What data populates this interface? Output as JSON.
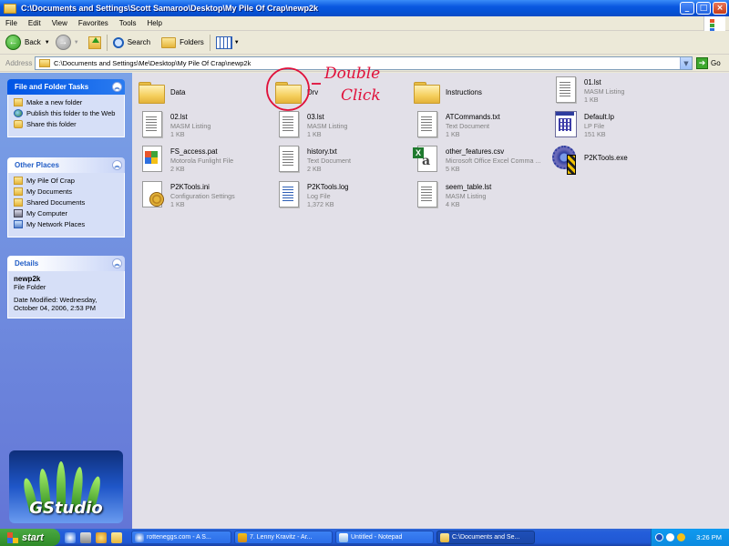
{
  "window": {
    "title": "C:\\Documents and Settings\\Scott Samaroo\\Desktop\\My Pile Of Crap\\newp2k",
    "controls": {
      "minimize": "_",
      "maximize": "□",
      "close": "×"
    }
  },
  "menu": [
    "File",
    "Edit",
    "View",
    "Favorites",
    "Tools",
    "Help"
  ],
  "toolbar": {
    "back": "Back",
    "search": "Search",
    "folders": "Folders"
  },
  "address": {
    "label": "Address",
    "value": "C:\\Documents and Settings\\Me\\Desktop\\My Pile Of Crap\\newp2k",
    "go": "Go"
  },
  "sidebar": {
    "tasks": {
      "title": "File and Folder Tasks",
      "items": [
        {
          "label": "Make a new folder",
          "icon": "new-folder-icon"
        },
        {
          "label": "Publish this folder to the Web",
          "icon": "globe-icon"
        },
        {
          "label": "Share this folder",
          "icon": "share-icon"
        }
      ]
    },
    "places": {
      "title": "Other Places",
      "items": [
        {
          "label": "My Pile Of Crap",
          "icon": "folder-icon"
        },
        {
          "label": "My Documents",
          "icon": "documents-icon"
        },
        {
          "label": "Shared Documents",
          "icon": "folder-icon"
        },
        {
          "label": "My Computer",
          "icon": "computer-icon"
        },
        {
          "label": "My Network Places",
          "icon": "network-icon"
        }
      ]
    },
    "details": {
      "title": "Details",
      "name": "newp2k",
      "type": "File Folder",
      "modified": "Date Modified: Wednesday, October 04, 2006, 2:53 PM"
    },
    "logo_text": "GStudio"
  },
  "files": [
    {
      "name": "Data",
      "type": "",
      "size": "",
      "icon": "folder"
    },
    {
      "name": "Drv",
      "type": "",
      "size": "",
      "icon": "folder"
    },
    {
      "name": "Instructions",
      "type": "",
      "size": "",
      "icon": "folder"
    },
    {
      "name": "01.lst",
      "type": "MASM Listing",
      "size": "1 KB",
      "icon": "doc"
    },
    {
      "name": "02.lst",
      "type": "MASM Listing",
      "size": "1 KB",
      "icon": "doc"
    },
    {
      "name": "03.lst",
      "type": "MASM Listing",
      "size": "1 KB",
      "icon": "doc"
    },
    {
      "name": "ATCommands.txt",
      "type": "Text Document",
      "size": "1 KB",
      "icon": "doc"
    },
    {
      "name": "Default.lp",
      "type": "LP File",
      "size": "151 KB",
      "icon": "lp"
    },
    {
      "name": "FS_access.pat",
      "type": "Motorola Funlight File",
      "size": "2 KB",
      "icon": "pat"
    },
    {
      "name": "history.txt",
      "type": "Text Document",
      "size": "2 KB",
      "icon": "doc"
    },
    {
      "name": "other_features.csv",
      "type": "Microsoft Office Excel Comma ...",
      "size": "5 KB",
      "icon": "xl"
    },
    {
      "name": "P2KTools.exe",
      "type": "",
      "size": "",
      "icon": "exe"
    },
    {
      "name": "P2KTools.ini",
      "type": "Configuration Settings",
      "size": "1 KB",
      "icon": "ini"
    },
    {
      "name": "P2KTools.log",
      "type": "Log File",
      "size": "1,372 KB",
      "icon": "ldoc"
    },
    {
      "name": "seem_table.lst",
      "type": "MASM Listing",
      "size": "4 KB",
      "icon": "doc"
    }
  ],
  "annotation": {
    "line1": "Double",
    "line2": "Click",
    "color": "#E0103A"
  },
  "taskbar": {
    "start": "start",
    "buttons": [
      {
        "label": "rotteneggs.com - A S...",
        "active": false
      },
      {
        "label": "7. Lenny Kravitz - Ar...",
        "active": false
      },
      {
        "label": "Untitled - Notepad",
        "active": false
      },
      {
        "label": "C:\\Documents and Se...",
        "active": true
      }
    ],
    "clock": "3:26 PM"
  },
  "colors": {
    "sidebar_top": "#7BA2E7",
    "sidebar_bottom": "#6375D6",
    "titlebar": "#0552D6",
    "content_bg": "#E2E0E8"
  }
}
